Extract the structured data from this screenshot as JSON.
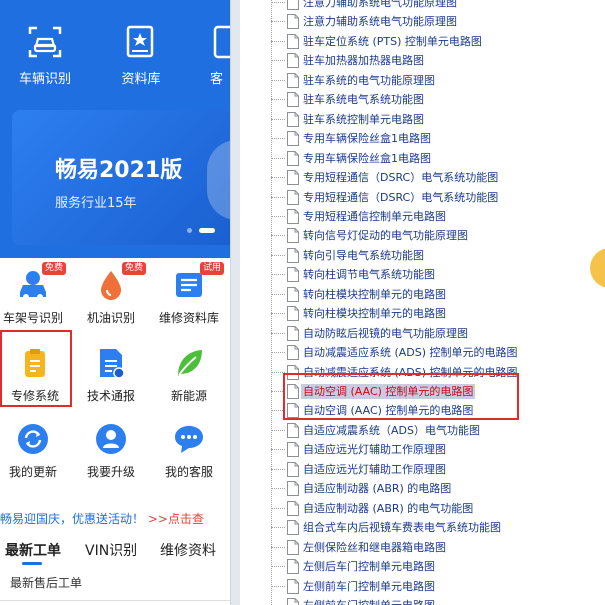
{
  "top_nav": [
    {
      "label": "车辆识别",
      "icon": "car-scan-icon"
    },
    {
      "label": "资料库",
      "icon": "book-icon"
    },
    {
      "label": "客",
      "icon": "customer-icon"
    }
  ],
  "banner": {
    "title": "畅易2021版",
    "subtitle": "服务行业15年"
  },
  "grid": [
    {
      "label": "车架号识别",
      "icon": "vin-car-icon",
      "badge": "免费"
    },
    {
      "label": "机油识别",
      "icon": "oil-icon",
      "badge": "免费"
    },
    {
      "label": "维修资料库",
      "icon": "manual-icon",
      "badge": "试用"
    },
    {
      "label": "专修系统",
      "icon": "clipboard-icon",
      "badge": ""
    },
    {
      "label": "技术通报",
      "icon": "bulletin-icon",
      "badge": ""
    },
    {
      "label": "新能源",
      "icon": "leaf-icon",
      "badge": ""
    },
    {
      "label": "我的更新",
      "icon": "refresh-icon",
      "badge": ""
    },
    {
      "label": "我要升级",
      "icon": "user-upgrade-icon",
      "badge": ""
    },
    {
      "label": "我的客服",
      "icon": "chat-icon",
      "badge": ""
    }
  ],
  "promo": {
    "text": "畅易迎国庆，优惠送活动！",
    "link": ">>点击查"
  },
  "tabs": [
    "最新工单",
    "VIN识别",
    "维修资料"
  ],
  "subhead": "最新售后工单",
  "colors": {
    "brand_blue": "#1f6fe0",
    "highlight_red": "#e22b2b",
    "badge_red": "#e8423a"
  },
  "tree": {
    "items": [
      "注意力辅助系统电气功能原理图",
      "注意力辅助系统电气功能原理图",
      "驻车定位系统 (PTS) 控制单元电路图",
      "驻车加热器加热器电路图",
      "驻车系统的电气功能原理图",
      "驻车系统电气系统功能图",
      "驻车系统控制单元电路图",
      "专用车辆保险丝盒1电路图",
      "专用车辆保险丝盒1电路图",
      "专用短程通信（DSRC）电气系统功能图",
      "专用短程通信（DSRC）电气系统功能图",
      "专用短程通信控制单元电路图",
      "转向信号灯促动的电气功能原理图",
      "转向引导电气系统功能图",
      "转向柱调节电气系统功能图",
      "转向柱模块控制单元的电路图",
      "转向柱模块控制单元的电路图",
      "自动防眩后视镜的电气功能原理图",
      "自动减震适应系统 (ADS) 控制单元的电路图",
      "自动减震适应系统 (ADS) 控制单元的电路图",
      "自动空调 (AAC) 控制单元的电路图",
      "自动空调 (AAC) 控制单元的电路图",
      "自适应减震系统（ADS）电气功能图",
      "自适应远光灯辅助工作原理图",
      "自适应远光灯辅助工作原理图",
      "自适应制动器 (ABR) 的电路图",
      "自适应制动器 (ABR) 的电气功能图",
      "组合式车内后视镜车费表电气系统功能图",
      "左侧保险丝和继电器箱电路图",
      "左侧后车门控制单元电路图",
      "左侧前车门控制单元电路图",
      "左侧前车门控制单元电路图"
    ],
    "selected_index": 20
  }
}
